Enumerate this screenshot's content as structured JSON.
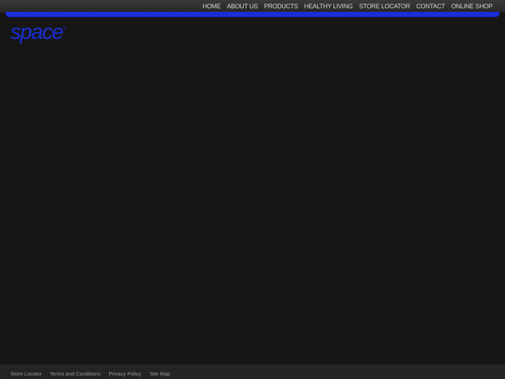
{
  "header": {
    "nav": [
      {
        "label": "HOME"
      },
      {
        "label": "ABOUT US"
      },
      {
        "label": "PRODUCTS"
      },
      {
        "label": "HEALTHY LIVING"
      },
      {
        "label": "STORE LOCATOR"
      },
      {
        "label": "CONTACT"
      },
      {
        "label": "ONLINE SHOP"
      }
    ],
    "logo": {
      "text": "space",
      "mark": "®"
    }
  },
  "footer": {
    "links": [
      {
        "label": "Store Locator"
      },
      {
        "label": "Terms and Conditions"
      },
      {
        "label": "Privacy Policy"
      },
      {
        "label": "Site Map"
      }
    ]
  },
  "colors": {
    "brand_blue": "#1a2fd6",
    "background": "#161616",
    "topbar": "#2e2e2e",
    "footer": "#242424"
  }
}
